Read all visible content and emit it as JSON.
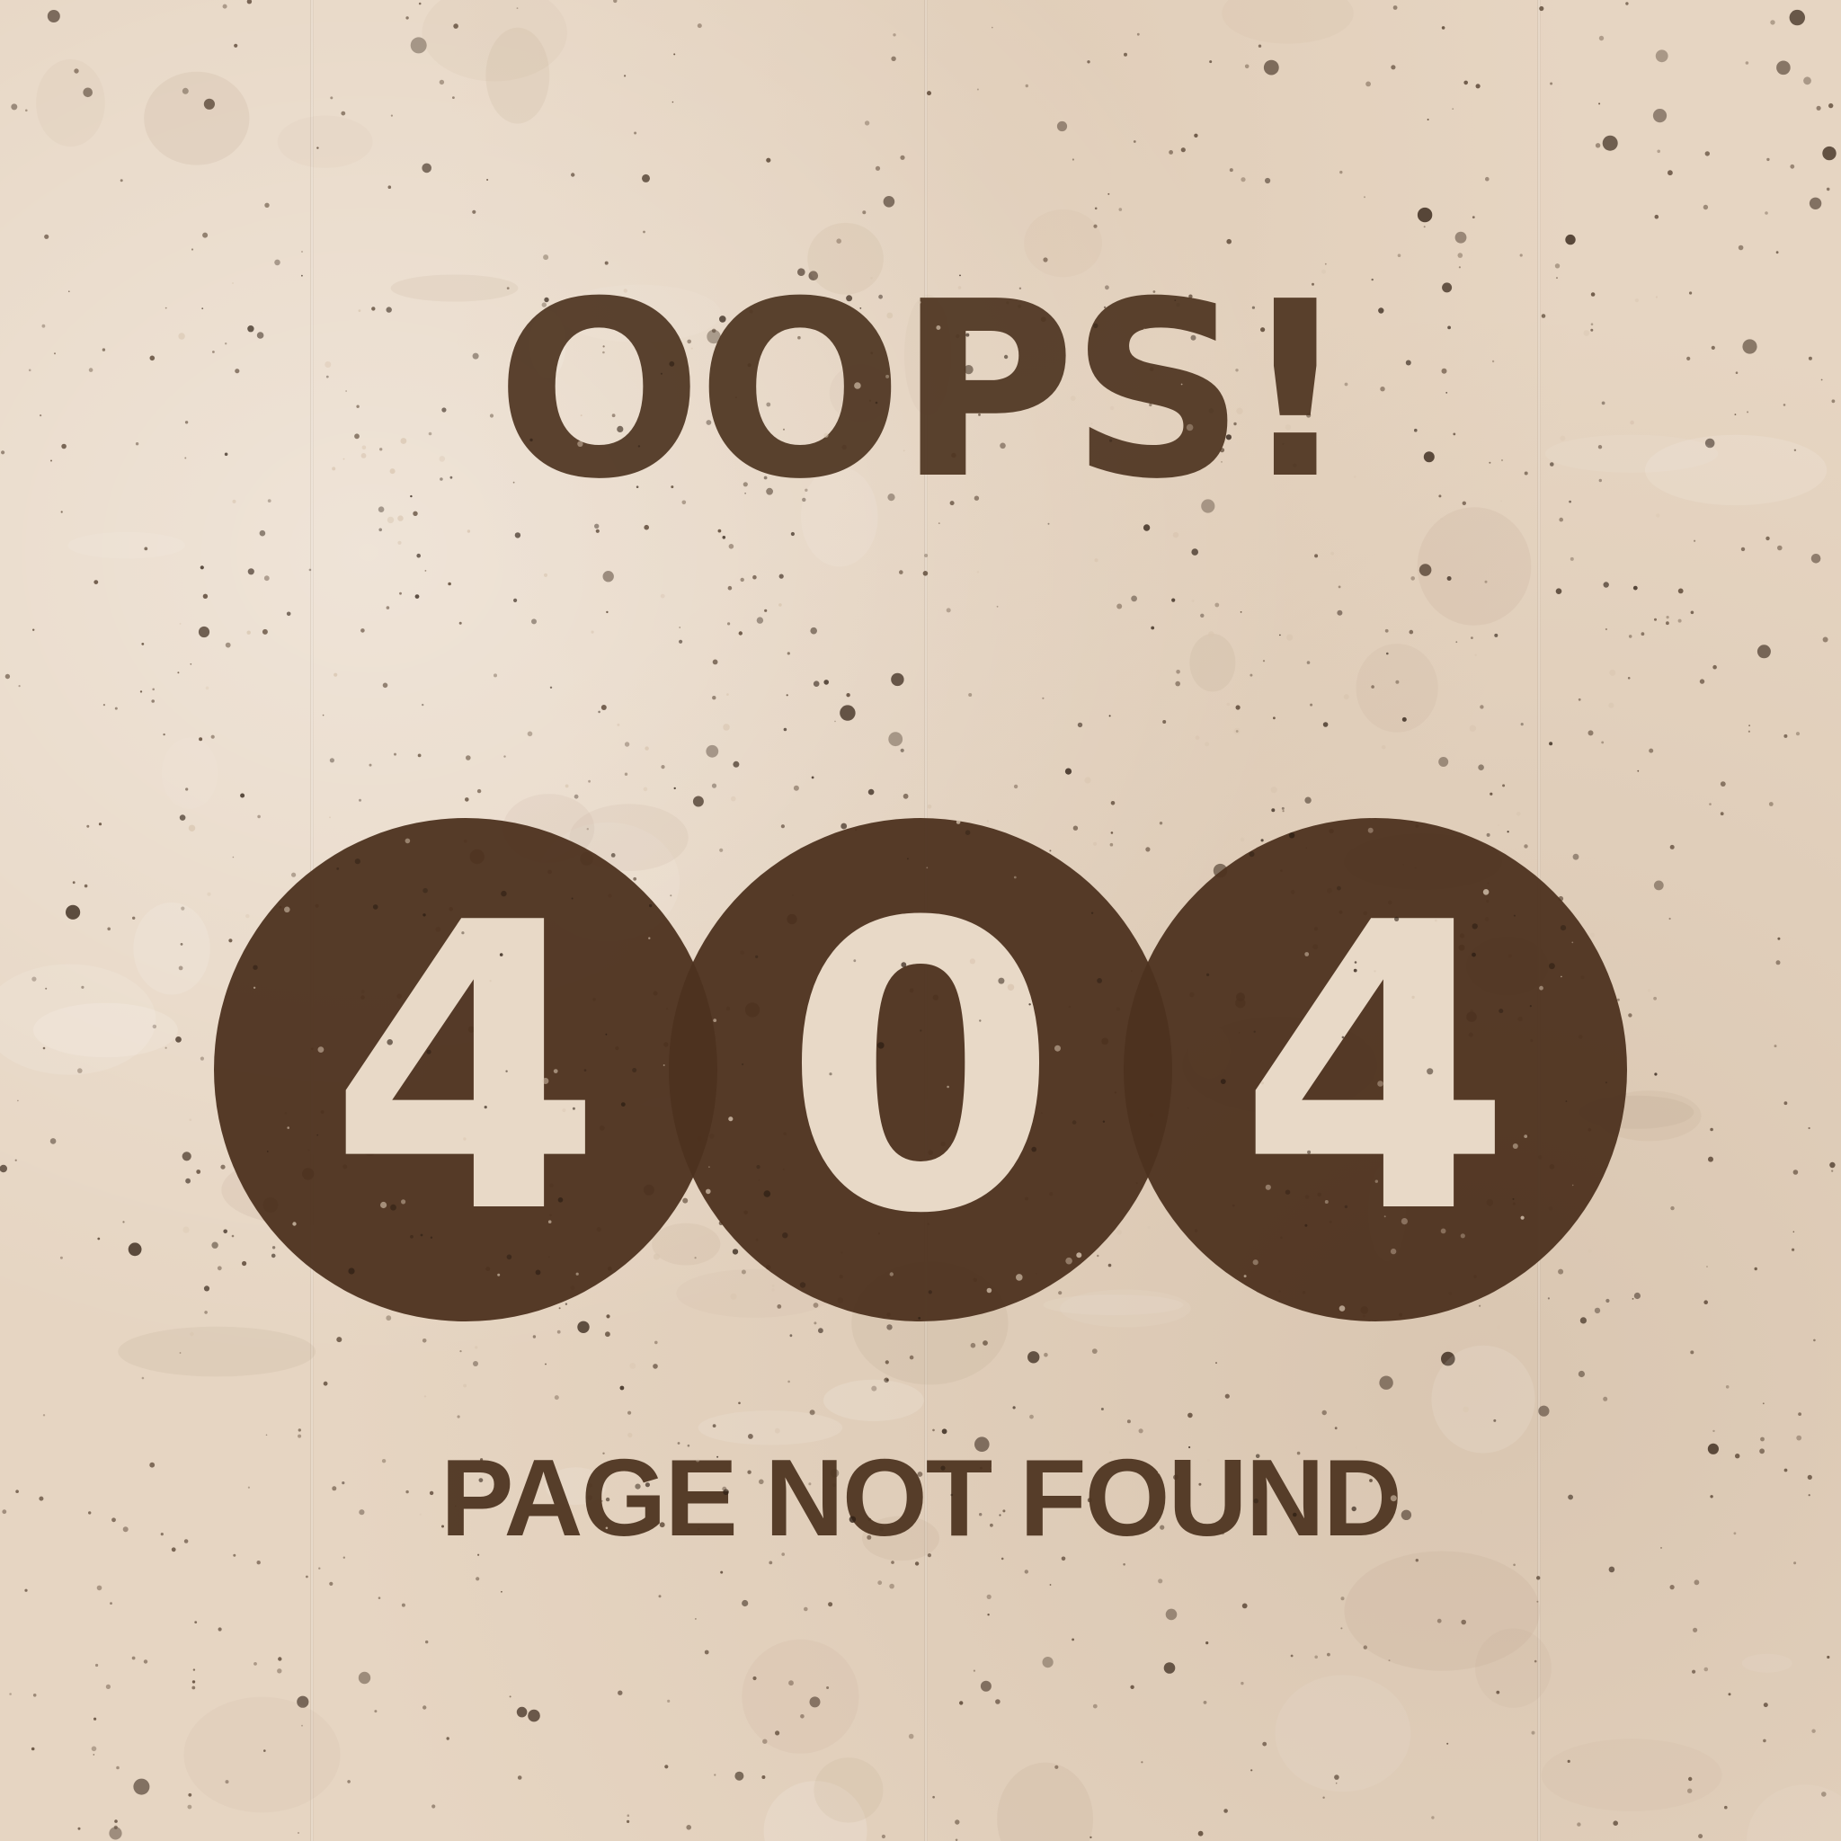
{
  "page": {
    "heading": "OOPS!",
    "error_code_digits": [
      "4",
      "0",
      "4"
    ],
    "subheading": "PAGE NOT FOUND"
  },
  "colors": {
    "background": "#e6d5c2",
    "ink": "#4f3622",
    "circle": "#4d321f",
    "digit": "#e8d9c7"
  },
  "decor": {
    "background_texture": "concrete-wall"
  }
}
